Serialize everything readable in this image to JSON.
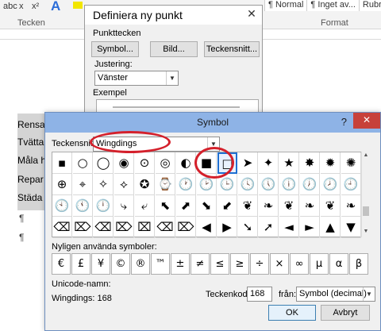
{
  "word": {
    "format_icons": [
      "abc",
      "x",
      "x²"
    ],
    "styles": [
      "¶ Normal",
      "¶ Inget av...",
      "Rubri"
    ],
    "group_labels": {
      "font": "Tecken",
      "styles": "Format"
    },
    "doc_lines": [
      "Rensa",
      "Tvätta",
      "Måla h",
      "Repar",
      "Städa"
    ],
    "pilcrow": "¶"
  },
  "define_dialog": {
    "title": "Definiera ny punkt",
    "close": "✕",
    "group_label": "Punkttecken",
    "buttons": {
      "symbol": "Symbol...",
      "image": "Bild...",
      "font": "Teckensnitt..."
    },
    "alignment_label": "Justering:",
    "alignment_value": "Vänster",
    "example_label": "Exempel"
  },
  "symbol_dialog": {
    "title": "Symbol",
    "help": "?",
    "close": "✕",
    "font_label": "Teckensnitt:",
    "font_value": "Wingdings",
    "grid": [
      [
        "▪",
        "○",
        "◯",
        "◉",
        "⊙",
        "◎",
        "◐",
        "■",
        "□",
        "➤",
        "✦",
        "★",
        "✸",
        "✹",
        "✺"
      ],
      [
        "⊕",
        "⌖",
        "✧",
        "⟡",
        "✪",
        "⌚",
        "🕐",
        "🕑",
        "🕒",
        "🕓",
        "🕔",
        "🕕",
        "🕖",
        "🕗",
        "🕘"
      ],
      [
        "🕙",
        "🕚",
        "🕛",
        "⤷",
        "⤶",
        "⬉",
        "⬈",
        "⬊",
        "⬋",
        "❦",
        "❧",
        "❦",
        "❧",
        "❦",
        "❧"
      ],
      [
        "⌫",
        "⌦",
        "⌫",
        "⌦",
        "⌧",
        "⌫",
        "⌦",
        "◀",
        "▶",
        "➘",
        "➚",
        "◄",
        "►",
        "▲",
        "▼"
      ]
    ],
    "selected_cell": "□",
    "recent_label": "Nyligen använda symboler:",
    "recent": [
      "€",
      "£",
      "¥",
      "©",
      "®",
      "™",
      "±",
      "≠",
      "≤",
      "≥",
      "÷",
      "×",
      "∞",
      "µ",
      "α",
      "β"
    ],
    "unicode_label": "Unicode-namn:",
    "unicode_value": "Wingdings: 168",
    "charcode_label": "Teckenkod:",
    "charcode_value": "168",
    "from_label": "från:",
    "from_value": "Symbol (decimal)",
    "ok": "OK",
    "cancel": "Avbryt"
  }
}
